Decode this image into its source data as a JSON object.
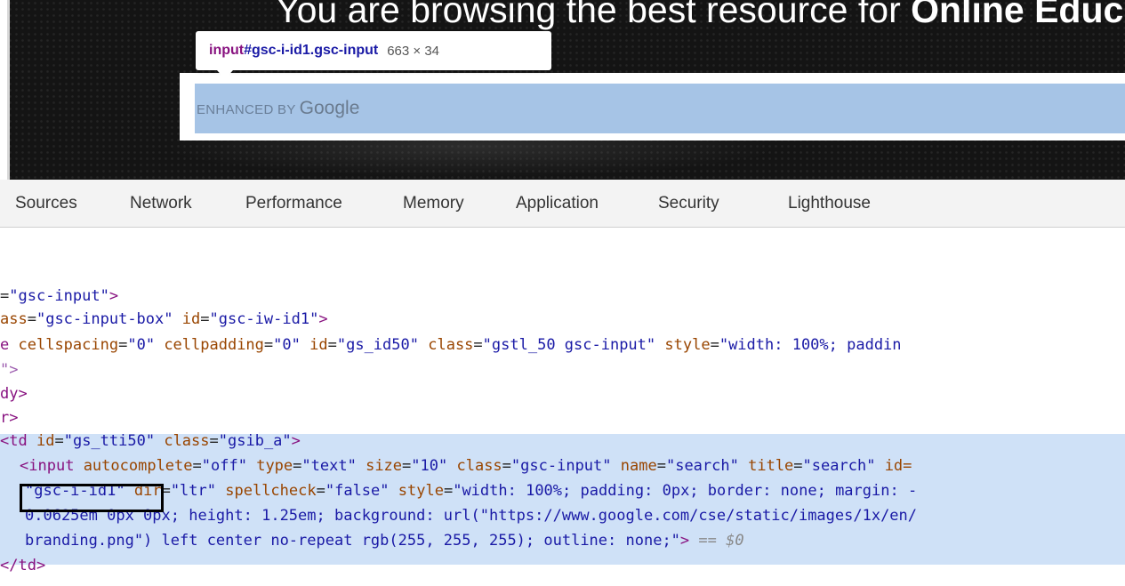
{
  "site": {
    "headline_prefix": "You are browsing the best resource for ",
    "headline_bold": "Online Educ",
    "search_branding_enhanced": "ENHANCED BY",
    "search_branding_google": "Google"
  },
  "tooltip": {
    "tag": "input",
    "selector": "#gsc-i-id1.gsc-input",
    "dimensions": "663 × 34"
  },
  "devtools_tabs": [
    "Sources",
    "Network",
    "Performance",
    "Memory",
    "Application",
    "Security",
    "Lighthouse"
  ],
  "code_lines": {
    "l1_val": "\"gsc-input\"",
    "l2_attr": "ass",
    "l2_class_val": "\"gsc-input-box\"",
    "l2_id_attr": "id",
    "l2_id_val": "\"gsc-iw-id1\"",
    "l3_prefix": "e",
    "l3_attr1": "cellspacing",
    "l3_val1": "\"0\"",
    "l3_attr2": "cellpadding",
    "l3_val2": "\"0\"",
    "l3_attr3": "id",
    "l3_val3": "\"gs_id50\"",
    "l3_attr4": "class",
    "l3_val4": "\"gstl_50 gsc-input\"",
    "l3_attr5": "style",
    "l3_val5": "\"width: 100%; paddin",
    "l4_text": "\">",
    "l5_text": "dy>",
    "l6_text": "r>",
    "l7_tag": "td",
    "l7_attr1": "id",
    "l7_val1": "\"gs_tti50\"",
    "l7_attr2": "class",
    "l7_val2": "\"gsib_a\"",
    "l8_tag": "input",
    "l8_attr1": "autocomplete",
    "l8_val1": "\"off\"",
    "l8_attr2": "type",
    "l8_val2": "\"text\"",
    "l8_attr3": "size",
    "l8_val3": "\"10\"",
    "l8_attr4": "class",
    "l8_val4": "\"gsc-input\"",
    "l8_attr5": "name",
    "l8_val5": "\"search\"",
    "l8_attr6": "title",
    "l8_val6": "\"search\"",
    "l8_attr7": "id=",
    "l9_id_val": "\"gsc-i-id1\"",
    "l9_attr1": "dir",
    "l9_val1": "\"ltr\"",
    "l9_attr2": "spellcheck",
    "l9_val2": "\"false\"",
    "l9_attr3": "style",
    "l9_val3": "\"width: 100%; padding: 0px; border: none; margin: -",
    "l10_text": "0.0625em 0px 0px; height: 1.25em; background: url(\"https://www.google.com/cse/static/images/1x/en/",
    "l11_text": "branding.png\") left center no-repeat rgb(255, 255, 255); outline: none;\"",
    "l11_eq": "== $0",
    "l12_text": "</td>"
  }
}
